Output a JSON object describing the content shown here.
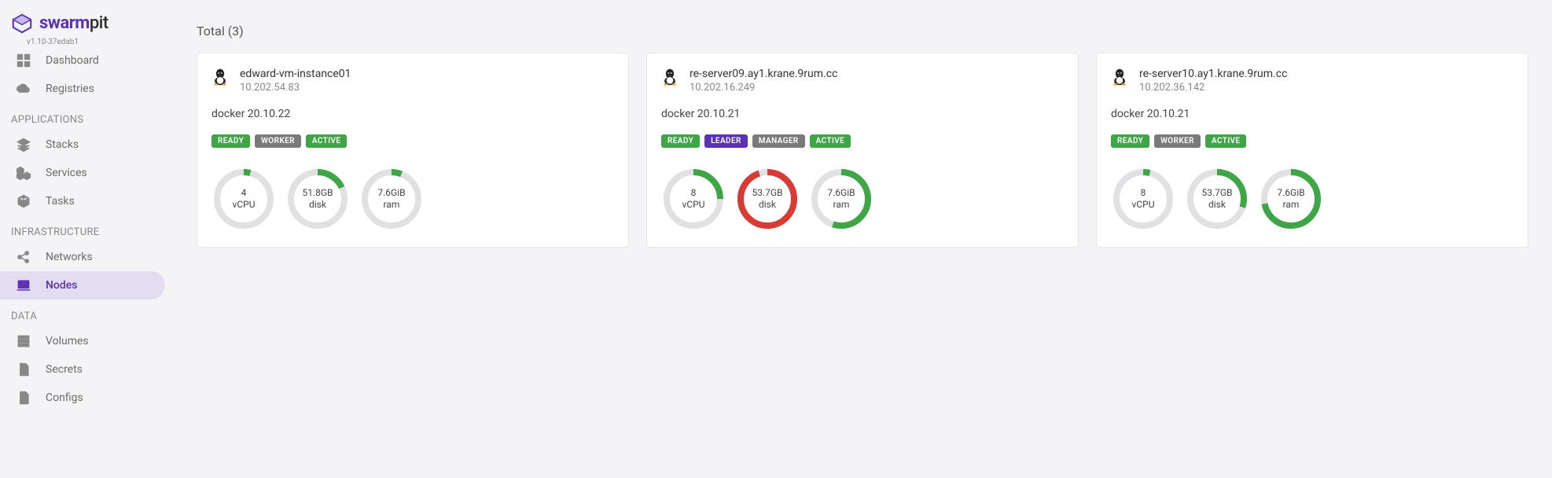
{
  "logo": {
    "bold": "swarm",
    "light": "pit",
    "version": "v1.10-37edab1"
  },
  "nav": {
    "top": [
      {
        "label": "Dashboard",
        "icon": "grid-icon"
      },
      {
        "label": "Registries",
        "icon": "cloud-icon"
      }
    ],
    "sections": [
      {
        "title": "APPLICATIONS",
        "items": [
          {
            "label": "Stacks",
            "icon": "layers-icon"
          },
          {
            "label": "Services",
            "icon": "cubes-icon"
          },
          {
            "label": "Tasks",
            "icon": "cube-icon"
          }
        ]
      },
      {
        "title": "INFRASTRUCTURE",
        "items": [
          {
            "label": "Networks",
            "icon": "share-icon"
          },
          {
            "label": "Nodes",
            "icon": "laptop-icon",
            "active": true
          }
        ]
      },
      {
        "title": "DATA",
        "items": [
          {
            "label": "Volumes",
            "icon": "storage-icon"
          },
          {
            "label": "Secrets",
            "icon": "file-key-icon"
          },
          {
            "label": "Configs",
            "icon": "file-gear-icon"
          }
        ]
      }
    ]
  },
  "total_label": "Total (3)",
  "nodes": [
    {
      "name": "edward-vm-instance01",
      "ip": "10.202.54.83",
      "docker": "docker 20.10.22",
      "badges": [
        {
          "text": "READY",
          "class": "ready"
        },
        {
          "text": "WORKER",
          "class": "worker"
        },
        {
          "text": "ACTIVE",
          "class": "active"
        }
      ],
      "gauges": [
        {
          "value": "4",
          "unit": "vCPU",
          "pct": 4,
          "color": "#3fa648"
        },
        {
          "value": "51.8GB",
          "unit": "disk",
          "pct": 18,
          "color": "#3fa648"
        },
        {
          "value": "7.6GiB",
          "unit": "ram",
          "pct": 6,
          "color": "#3fa648"
        }
      ]
    },
    {
      "name": "re-server09.ay1.krane.9rum.cc",
      "ip": "10.202.16.249",
      "docker": "docker 20.10.21",
      "badges": [
        {
          "text": "READY",
          "class": "ready"
        },
        {
          "text": "LEADER",
          "class": "leader"
        },
        {
          "text": "MANAGER",
          "class": "manager"
        },
        {
          "text": "ACTIVE",
          "class": "active"
        }
      ],
      "gauges": [
        {
          "value": "8",
          "unit": "vCPU",
          "pct": 25,
          "color": "#3fa648"
        },
        {
          "value": "53.7GB",
          "unit": "disk",
          "pct": 95,
          "color": "#d83a34"
        },
        {
          "value": "7.6GiB",
          "unit": "ram",
          "pct": 55,
          "color": "#3fa648"
        }
      ]
    },
    {
      "name": "re-server10.ay1.krane.9rum.cc",
      "ip": "10.202.36.142",
      "docker": "docker 20.10.21",
      "badges": [
        {
          "text": "READY",
          "class": "ready"
        },
        {
          "text": "WORKER",
          "class": "worker"
        },
        {
          "text": "ACTIVE",
          "class": "active"
        }
      ],
      "gauges": [
        {
          "value": "8",
          "unit": "vCPU",
          "pct": 4,
          "color": "#3fa648"
        },
        {
          "value": "53.7GB",
          "unit": "disk",
          "pct": 30,
          "color": "#3fa648"
        },
        {
          "value": "7.6GiB",
          "unit": "ram",
          "pct": 72,
          "color": "#3fa648"
        }
      ]
    }
  ]
}
